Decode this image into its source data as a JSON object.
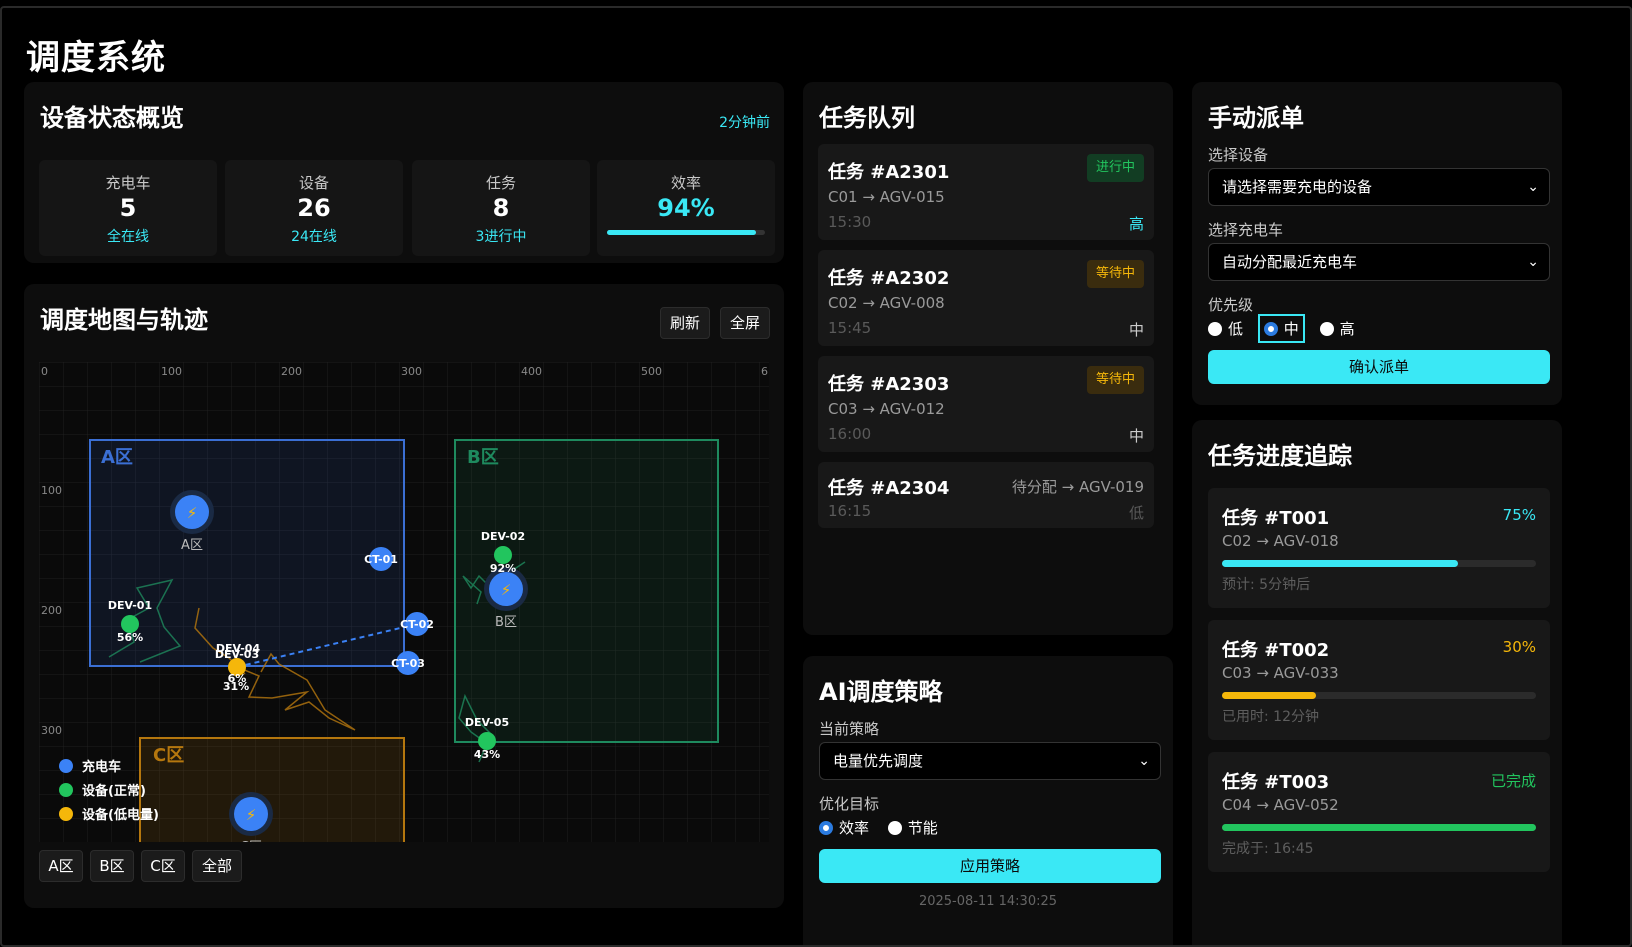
{
  "app": {
    "title": "调度系统"
  },
  "overview": {
    "title": "设备状态概览",
    "updated": "2分钟前",
    "cards": [
      {
        "label": "充电车",
        "value": "5",
        "sub": "全在线"
      },
      {
        "label": "设备",
        "value": "26",
        "sub": "24在线"
      },
      {
        "label": "任务",
        "value": "8",
        "sub": "3进行中"
      },
      {
        "label": "效率",
        "value": "94%",
        "progress": 0.94
      }
    ]
  },
  "map": {
    "title": "调度地图与轨迹",
    "refresh_label": "刷新",
    "fullscreen_label": "全屏",
    "x_ticks": [
      "0",
      "100",
      "200",
      "300",
      "400",
      "500",
      "6"
    ],
    "y_ticks": [
      "100",
      "200",
      "300"
    ],
    "zones": [
      {
        "label": "A区",
        "color": "#3b6fd4"
      },
      {
        "label": "B区",
        "color": "#1e8a5e"
      },
      {
        "label": "C区",
        "color": "#b5770e"
      }
    ],
    "stations": [
      {
        "label": "A区"
      },
      {
        "label": "B区"
      },
      {
        "label": "C区"
      }
    ],
    "chargers": [
      {
        "label": "CT-01"
      },
      {
        "label": "CT-02"
      },
      {
        "label": "CT-03"
      }
    ],
    "devices": [
      {
        "name": "DEV-01",
        "battery": "56%",
        "status": "normal"
      },
      {
        "name": "DEV-02",
        "battery": "92%",
        "status": "normal"
      },
      {
        "name": "DEV-03",
        "battery": "6%",
        "status": "low"
      },
      {
        "name": "DEV-04",
        "battery": "31%",
        "status": "low"
      },
      {
        "name": "DEV-05",
        "battery": "43%",
        "status": "normal"
      }
    ],
    "legend": [
      {
        "label": "充电车",
        "color": "#3b82f6"
      },
      {
        "label": "设备(正常)",
        "color": "#22c55e"
      },
      {
        "label": "设备(低电量)",
        "color": "#f5b70a"
      }
    ],
    "filters": [
      "A区",
      "B区",
      "C区",
      "全部"
    ]
  },
  "queue": {
    "title": "任务队列",
    "tasks": [
      {
        "title": "任务 #A2301",
        "route": "C01 → AGV-015",
        "time": "15:30",
        "status": "进行中",
        "priority": "高"
      },
      {
        "title": "任务 #A2302",
        "route": "C02 → AGV-008",
        "time": "15:45",
        "status": "等待中",
        "priority": "中"
      },
      {
        "title": "任务 #A2303",
        "route": "C03 → AGV-012",
        "time": "16:00",
        "status": "等待中",
        "priority": "中"
      },
      {
        "title": "任务 #A2304",
        "route": "待分配 → AGV-019",
        "time": "16:15",
        "status": "",
        "priority": "低"
      }
    ]
  },
  "ai": {
    "title": "AI调度策略",
    "strategy_label": "当前策略",
    "strategy_value": "电量优先调度",
    "goal_label": "优化目标",
    "goals": [
      "效率",
      "节能"
    ],
    "apply_label": "应用策略",
    "timestamp": "2025-08-11 14:30:25"
  },
  "dispatch": {
    "title": "手动派单",
    "device_label": "选择设备",
    "device_placeholder": "请选择需要充电的设备",
    "charger_label": "选择充电车",
    "charger_value": "自动分配最近充电车",
    "priority_label": "优先级",
    "priorities": [
      "低",
      "中",
      "高"
    ],
    "confirm_label": "确认派单"
  },
  "progress": {
    "title": "任务进度追踪",
    "items": [
      {
        "title": "任务 #T001",
        "pct": "75%",
        "route": "C02 → AGV-018",
        "note": "预计: 5分钟后",
        "value": 0.75,
        "color": "#3ae8f5"
      },
      {
        "title": "任务 #T002",
        "pct": "30%",
        "route": "C03 → AGV-033",
        "note": "已用时: 12分钟",
        "value": 0.3,
        "color": "#f5b70a"
      },
      {
        "title": "任务 #T003",
        "pct": "已完成",
        "route": "C04 → AGV-052",
        "note": "完成于: 16:45",
        "value": 1.0,
        "color": "#22c55e"
      }
    ]
  }
}
